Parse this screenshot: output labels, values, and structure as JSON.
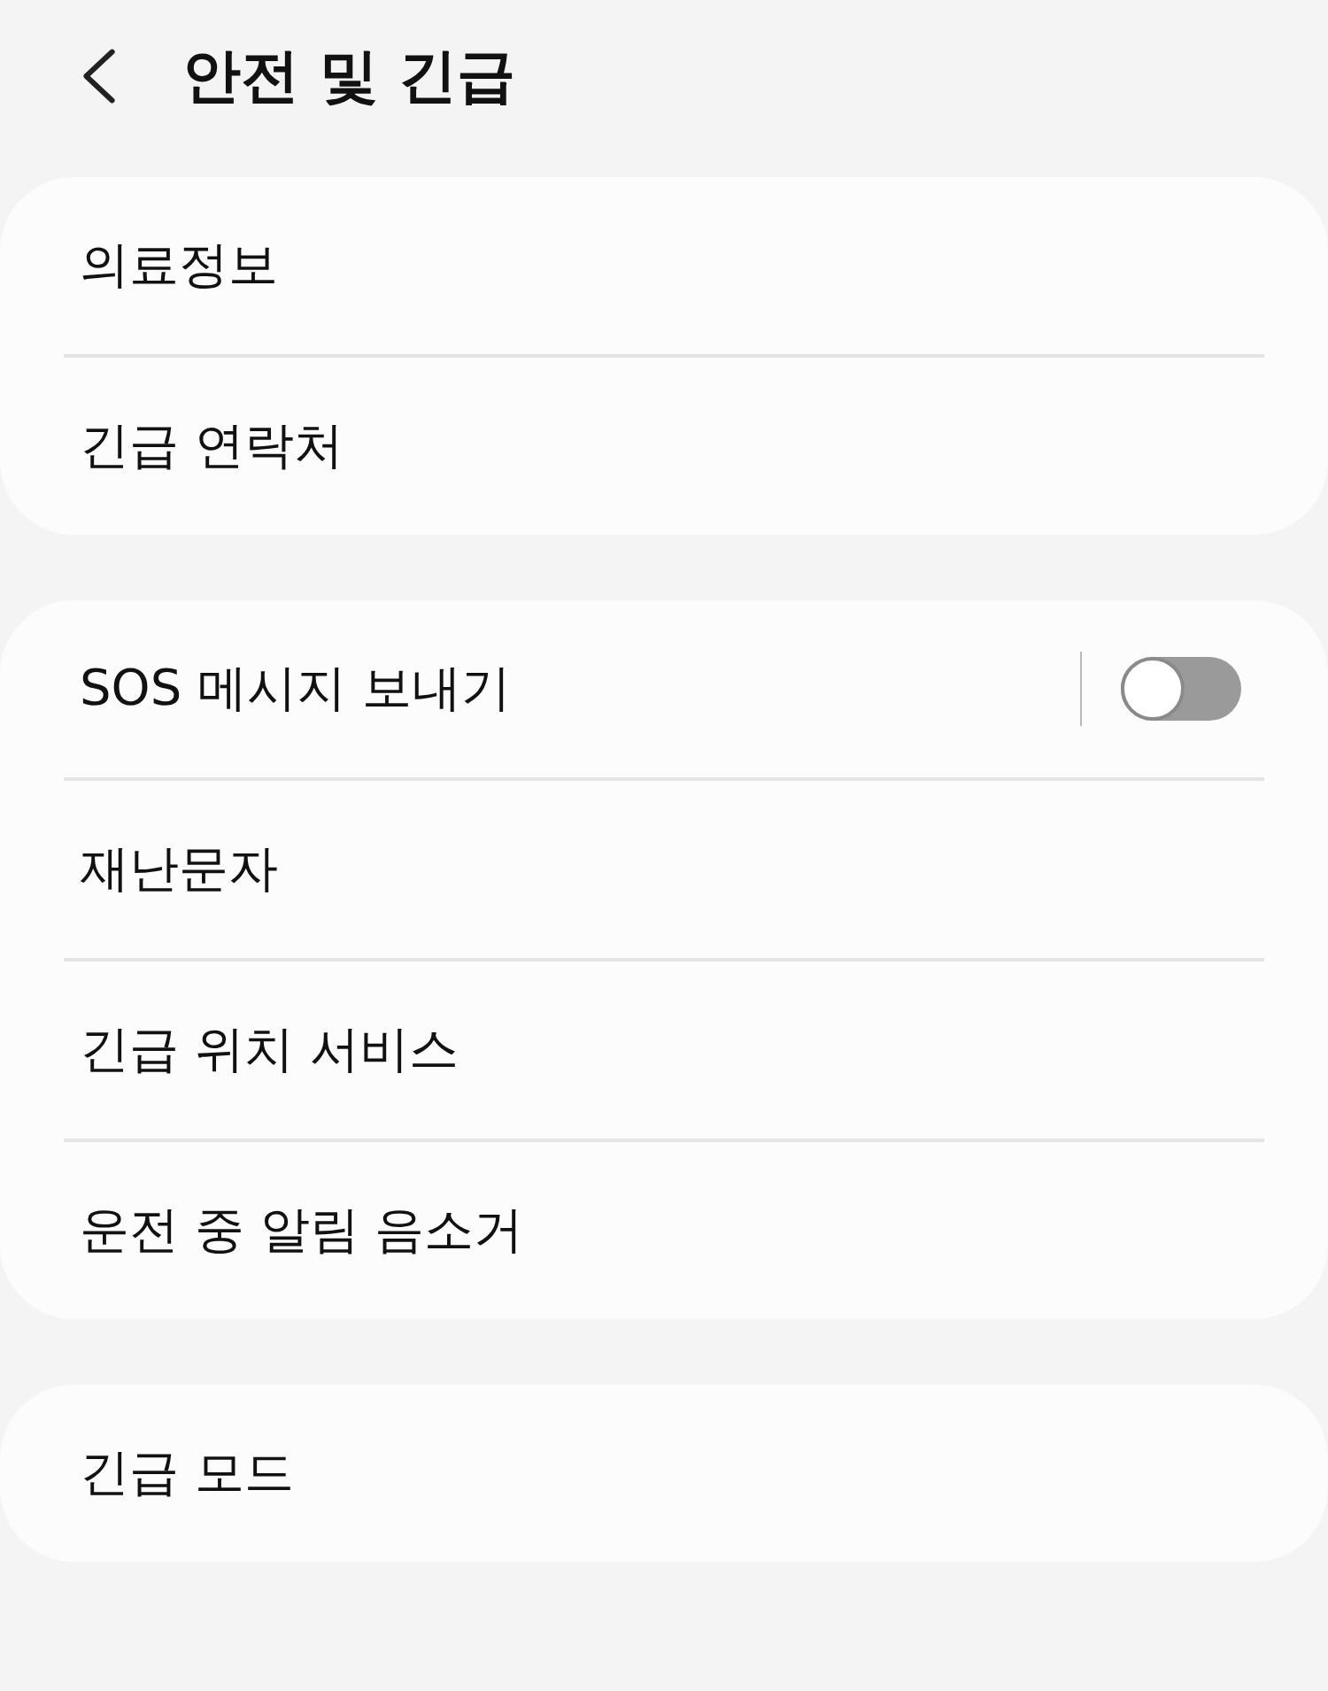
{
  "header": {
    "title": "안전 및 긴급"
  },
  "groups": [
    {
      "items": [
        {
          "kind": "link",
          "label": "의료정보"
        },
        {
          "kind": "link",
          "label": "긴급 연락처"
        }
      ]
    },
    {
      "items": [
        {
          "kind": "toggle",
          "label": "SOS 메시지 보내기",
          "on": false
        },
        {
          "kind": "link",
          "label": "재난문자"
        },
        {
          "kind": "link",
          "label": "긴급 위치 서비스"
        },
        {
          "kind": "link",
          "label": "운전 중 알림 음소거"
        }
      ]
    },
    {
      "items": [
        {
          "kind": "link",
          "label": "긴급 모드"
        }
      ]
    }
  ]
}
